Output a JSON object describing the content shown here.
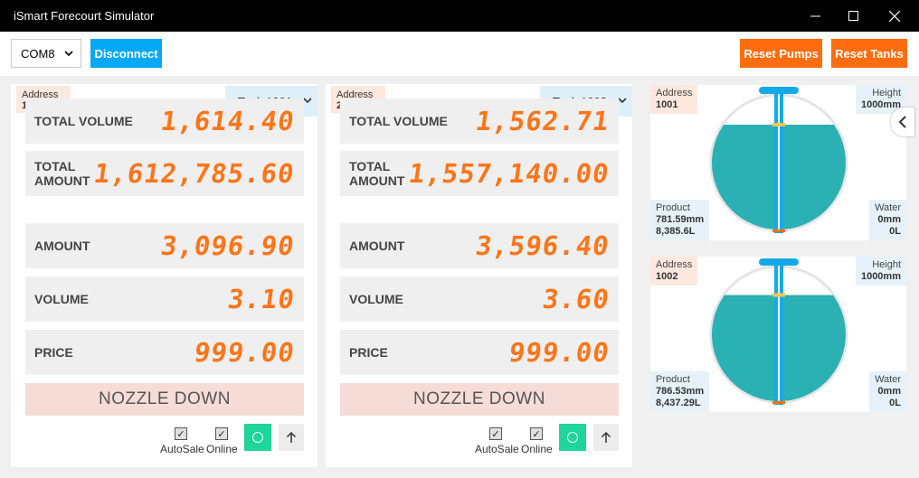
{
  "window": {
    "title": "iSmart Forecourt Simulator"
  },
  "toolbar": {
    "port": "COM8",
    "disconnect_label": "Disconnect",
    "reset_pumps_label": "Reset Pumps",
    "reset_tanks_label": "Reset Tanks"
  },
  "pumps": [
    {
      "address_label": "Address",
      "address": "1",
      "tank": "Tank 1001",
      "total_volume_label": "TOTAL VOLUME",
      "total_volume": "1,614.40",
      "total_amount_label": "TOTAL AMOUNT",
      "total_amount": "1,612,785.60",
      "amount_label": "AMOUNT",
      "amount": "3,096.90",
      "volume_label": "VOLUME",
      "volume": "3.10",
      "price_label": "PRICE",
      "price": "999.00",
      "nozzle_status": "NOZZLE DOWN",
      "autosale_label": "AutoSale",
      "online_label": "Online"
    },
    {
      "address_label": "Address",
      "address": "2",
      "tank": "Tank 1002",
      "total_volume_label": "TOTAL VOLUME",
      "total_volume": "1,562.71",
      "total_amount_label": "TOTAL AMOUNT",
      "total_amount": "1,557,140.00",
      "amount_label": "AMOUNT",
      "amount": "3,596.40",
      "volume_label": "VOLUME",
      "volume": "3.60",
      "price_label": "PRICE",
      "price": "999.00",
      "nozzle_status": "NOZZLE DOWN",
      "autosale_label": "AutoSale",
      "online_label": "Online"
    }
  ],
  "tanks": [
    {
      "address_label": "Address",
      "address": "1001",
      "height_label": "Height",
      "height": "1000mm",
      "product_label": "Product",
      "product_level": "781.59mm",
      "product_volume": "8,385.6L",
      "water_label": "Water",
      "water_level": "0mm",
      "water_volume": "0L",
      "fill_fraction": 0.78
    },
    {
      "address_label": "Address",
      "address": "1002",
      "height_label": "Height",
      "height": "1000mm",
      "product_label": "Product",
      "product_level": "786.53mm",
      "product_volume": "8,437.29L",
      "water_label": "Water",
      "water_level": "0mm",
      "water_volume": "0L",
      "fill_fraction": 0.79
    }
  ],
  "colors": {
    "accent_blue": "#03a9f4",
    "accent_orange": "#ff6d0e",
    "tank_fill": "#2bb0b3",
    "digit_orange": "#ff7518",
    "online_green": "#1ed69a"
  }
}
